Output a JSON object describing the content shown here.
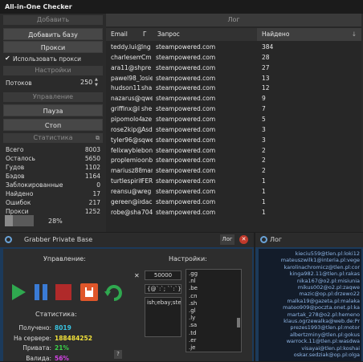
{
  "checker": {
    "title": "All-in-One Checker",
    "add_header": "Добавить",
    "add_base_button": "Добавить базу",
    "proxy_button": "Прокси",
    "use_proxy_label": "Использовать прокси",
    "use_proxy_checked": true,
    "settings_header": "Настройки",
    "threads_label": "Потоков",
    "threads_value": "250",
    "control_header": "Управление",
    "pause_button": "Пауза",
    "stop_button": "Стоп",
    "stats_header": "Статистика",
    "stats": [
      {
        "label": "Всего",
        "value": "8003"
      },
      {
        "label": "Осталось",
        "value": "5650"
      },
      {
        "label": "Гудов",
        "value": "1102"
      },
      {
        "label": "Бэдов",
        "value": "1164"
      },
      {
        "label": "Заблокированные",
        "value": "0"
      },
      {
        "label": "Найдено",
        "value": "17"
      },
      {
        "label": "Ошибок",
        "value": "217"
      },
      {
        "label": "Прокси",
        "value": "1252"
      }
    ],
    "progress_text": "28%",
    "progress": 0.28,
    "log_header": "Лог",
    "columns": [
      "Email",
      "Г",
      "Запрос",
      "Найдено"
    ],
    "rows": [
      {
        "email": "teddy.lui@",
        "g": "lng",
        "query": "steampowered.com",
        "found": "384"
      },
      {
        "email": "charlesema",
        "g": "Cm",
        "query": "steampowered.com",
        "found": "28"
      },
      {
        "email": "ara11@sha",
        "g": "pre",
        "query": "steampowered.com",
        "found": "27"
      },
      {
        "email": "pawel98_1",
        "g": "osie",
        "query": "steampowered.com",
        "found": "13"
      },
      {
        "email": "hudson111",
        "g": "sha",
        "query": "steampowered.com",
        "found": "12"
      },
      {
        "email": "nazarus@s",
        "g": "qwe",
        "query": "steampowered.com",
        "found": "9"
      },
      {
        "email": "griffinx@l",
        "g": "she",
        "query": "steampowered.com",
        "found": "7"
      },
      {
        "email": "pipomolo4",
        "g": "aze",
        "query": "steampowered.com",
        "found": "5"
      },
      {
        "email": "rose2kip@",
        "g": "Asd",
        "query": "steampowered.com",
        "found": "3"
      },
      {
        "email": "tyler96@sl",
        "g": "qwe",
        "query": "steampowered.com",
        "found": "3"
      },
      {
        "email": "felixwybier",
        "g": "bon",
        "query": "steampowered.com",
        "found": "2"
      },
      {
        "email": "proplemio",
        "g": "onb",
        "query": "steampowered.com",
        "found": "2"
      },
      {
        "email": "mariusz88",
        "g": "mar",
        "query": "steampowered.com",
        "found": "2"
      },
      {
        "email": "turtlespirit",
        "g": "FER",
        "query": "steampowered.com",
        "found": "1"
      },
      {
        "email": "reansu@w",
        "g": "reg",
        "query": "steampowered.com",
        "found": "1"
      },
      {
        "email": "gereen@ir",
        "g": "dac",
        "query": "steampowered.com",
        "found": "1"
      },
      {
        "email": "robe@sham",
        "g": "704",
        "query": "steampowered.com",
        "found": "1"
      }
    ]
  },
  "grabber": {
    "title": "Grabber Private Base",
    "log_button": "Лог",
    "control_label": "Управление:",
    "settings_label": "Настройки:",
    "count_value": "50000",
    "pattern_value": "{@`:`; ``:`}",
    "domains_value": "ish;ebay;steai",
    "tlds": [
      ".gg",
      ".nl",
      ".be",
      ".cn",
      ".sh",
      ".gl",
      ".ly",
      ".sa",
      ".td",
      ".er",
      ".je"
    ],
    "stats_label": "Статистика:",
    "stats": [
      {
        "label": "Получено:",
        "value": "8019",
        "color": "#39c3e0"
      },
      {
        "label": "На сервере:",
        "value": "188484252",
        "color": "#f2e23a"
      },
      {
        "label": "Привата:",
        "value": "21%",
        "color": "#3ad24a"
      },
      {
        "label": "Валида:",
        "value": "56%",
        "color": "#d543e6"
      }
    ],
    "help_glyph": "?"
  },
  "log_window": {
    "title": "Лог",
    "lines": [
      "kieciu559@tlen.pl:loki12",
      "mateuszwilk1@interia.pl:vege",
      "karolinachromicz@tlen.pl:cor",
      "kinga982.11@tlen.pl:rakas",
      "nika167@o2.pl:misiunia",
      "mikus002@o2.pl:zaqwe",
      "mazic@op.pl:drzewo22",
      "malka19@gazeta.pl:malaka",
      "mateo909@poczta.onet.pl:ka",
      "martak_278@o2.pl:hemeno",
      "klaus.ogrzewalka@web.de:Pr",
      "prezes1993@tlen.pl:motor",
      "albertzminy@tlen.pl:gokus",
      "warrock.11@tlen.pl:wasdwa",
      "visayai@tlen.pl:koshai",
      "oskar.sedziak@op.pl:olga"
    ]
  },
  "colors": {
    "accent_blue": "#1c3a5a",
    "log_text": "#8fb6e6",
    "close_red": "#c0392b",
    "stop_orange": "#e0562a"
  }
}
